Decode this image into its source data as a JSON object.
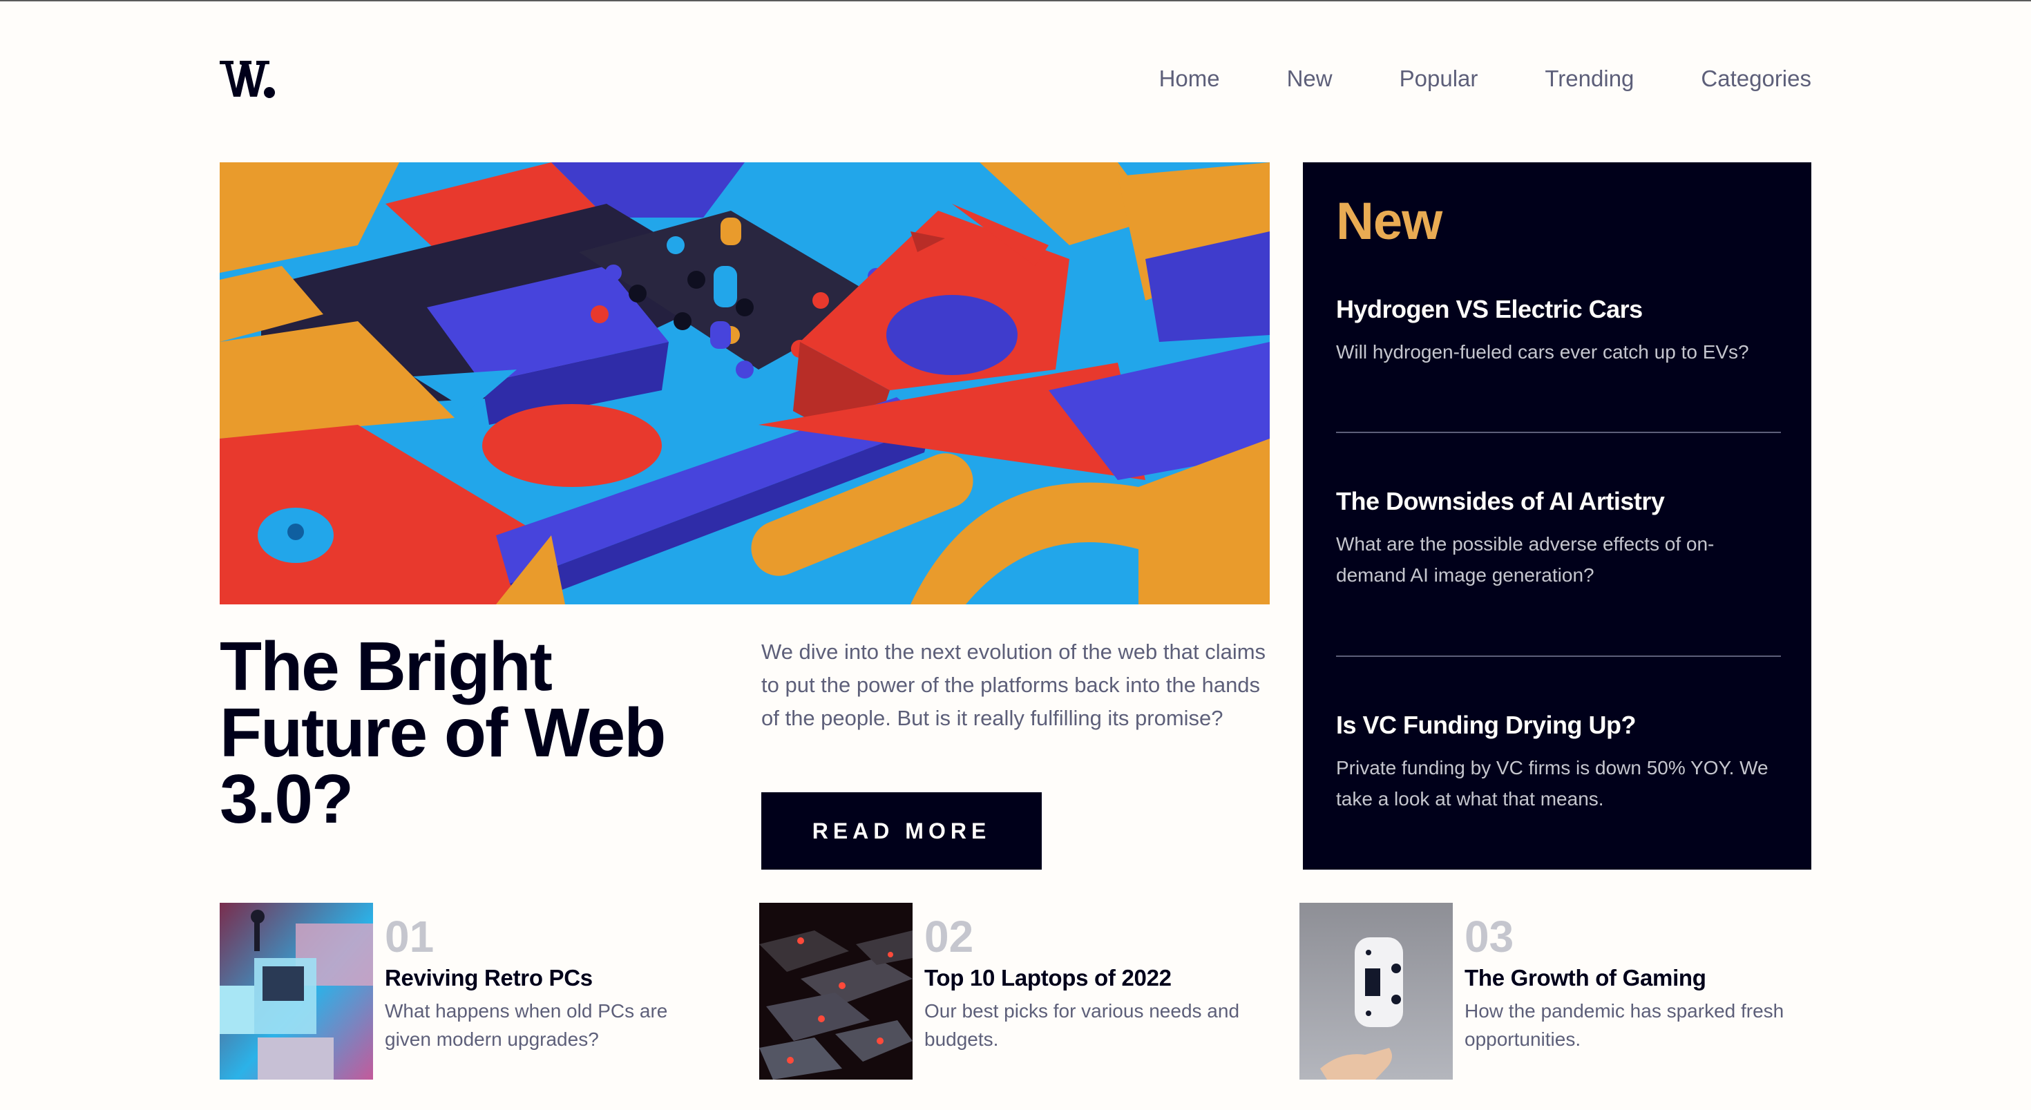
{
  "brand": {
    "logo_text": "W.",
    "logo_icon": "w-logo-icon"
  },
  "nav": {
    "items": [
      {
        "label": "Home"
      },
      {
        "label": "New"
      },
      {
        "label": "Popular"
      },
      {
        "label": "Trending"
      },
      {
        "label": "Categories"
      }
    ]
  },
  "hero": {
    "image_alt": "Colorful 3D geometric blocks",
    "title": "The Bright Future of Web 3.0?",
    "description": "We dive into the next evolution of the web that claims to put the power of the platforms back into the hands of the people. But is it really fulfilling its promise?",
    "button_label": "READ MORE"
  },
  "sidebar": {
    "heading": "New",
    "items": [
      {
        "title": "Hydrogen VS Electric Cars",
        "description": "Will hydrogen-fueled cars ever catch up to EVs?"
      },
      {
        "title": "The Downsides of AI Artistry",
        "description": "What are the possible adverse effects of on-demand AI image generation?"
      },
      {
        "title": "Is VC Funding Drying Up?",
        "description": "Private funding by VC firms is down 50% YOY. We take a look at what that means."
      }
    ]
  },
  "bottom": {
    "items": [
      {
        "number": "01",
        "title": "Reviving Retro PCs",
        "description": "What happens when old PCs are given modern upgrades?",
        "image_alt": "Retro computers"
      },
      {
        "number": "02",
        "title": "Top 10 Laptops of 2022",
        "description": "Our best picks for various needs and budgets.",
        "image_alt": "Laptop keyboard with red backlight"
      },
      {
        "number": "03",
        "title": "The Growth of Gaming",
        "description": "How the pandemic has sparked fresh opportunities.",
        "image_alt": "Game controller floating over hand"
      }
    ]
  },
  "colors": {
    "dark_navy": "#00001a",
    "accent_orange": "#e9ab53",
    "grayish_blue": "#5d5f79",
    "light_gray": "#c5c6ce",
    "off_white": "#fffdfa"
  }
}
